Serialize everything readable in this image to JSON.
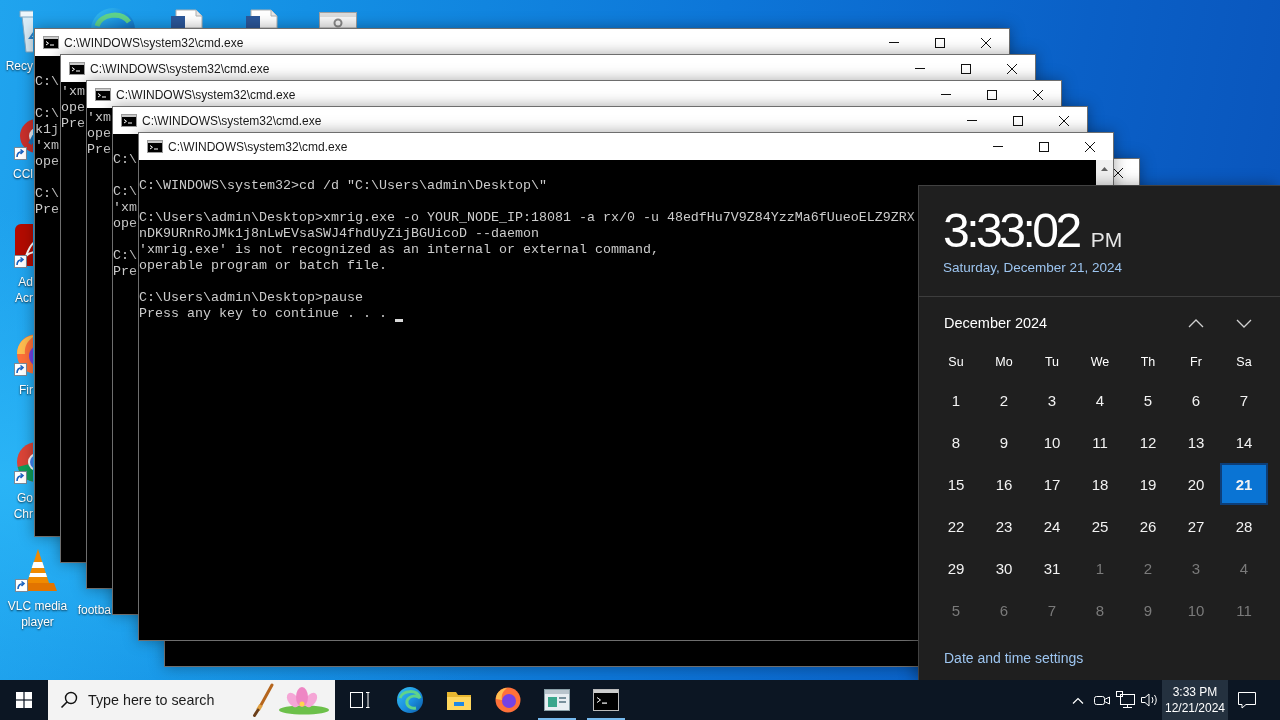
{
  "desktop": {
    "icons": [
      {
        "kind": "recycle_bin",
        "label_lines": [
          "Recy"
        ]
      },
      {
        "kind": "cleaner",
        "label_lines": [
          "CCl"
        ]
      },
      {
        "kind": "pdf_reader",
        "label_lines": [
          "Ad",
          "Acr"
        ]
      },
      {
        "kind": "fox_browser",
        "label_lines": [
          "Fir"
        ]
      },
      {
        "kind": "ring_browser",
        "label_lines": [
          "Go",
          "Chr"
        ]
      },
      {
        "kind": "cone_player",
        "label_lines": [
          "VLC media",
          "player"
        ]
      }
    ],
    "top_row": [
      {
        "kind": "swirl_browser"
      },
      {
        "kind": "document"
      },
      {
        "kind": "document"
      },
      {
        "kind": "settings_file"
      }
    ],
    "second_column": [
      {
        "label_lines": [
          "footba"
        ]
      }
    ]
  },
  "windows": [
    {
      "title": "C:\\WINDOWS\\system32\\cmd.exe",
      "buttons": [
        {
          "kind": "minimize"
        },
        {
          "kind": "maximize"
        },
        {
          "kind": "close"
        }
      ],
      "echo": true,
      "output": [
        [
          "C:\\"
        ],
        [
          "C:\\",
          "k1j",
          "'xm",
          "ope"
        ],
        [
          "C:\\",
          "Pre"
        ]
      ]
    },
    {
      "title": "C:\\WINDOWS\\system32\\cmd.exe",
      "buttons": [
        {
          "kind": "minimize"
        },
        {
          "kind": "maximize"
        },
        {
          "kind": "close"
        }
      ],
      "echo": false,
      "output": [
        [
          "'xm",
          "ope",
          "Pre"
        ]
      ]
    },
    {
      "title": "C:\\WINDOWS\\system32\\cmd.exe",
      "buttons": [
        {
          "kind": "minimize"
        },
        {
          "kind": "maximize"
        },
        {
          "kind": "close"
        }
      ],
      "echo": false,
      "output": [
        [
          "'xm",
          "ope",
          "Pre"
        ]
      ]
    },
    {
      "title": "C:\\WINDOWS\\system32\\cmd.exe",
      "buttons": [
        {
          "kind": "minimize"
        },
        {
          "kind": "maximize"
        },
        {
          "kind": "close"
        }
      ],
      "echo": true,
      "output": [
        [
          "C:\\"
        ],
        [
          "C:\\",
          "'xm",
          "ope"
        ],
        [
          "C:\\",
          "Pre"
        ]
      ]
    },
    {
      "title": "C:\\WINDOWS\\system32\\cmd.exe",
      "buttons": [
        {
          "kind": "minimize"
        },
        {
          "kind": "maximize"
        },
        {
          "kind": "close"
        }
      ],
      "echo": true,
      "cursor": true,
      "output": [
        [
          "C:\\WINDOWS\\system32>cd /d \"C:\\Users\\admin\\Desktop\\\""
        ],
        [
          "C:\\Users\\admin\\Desktop>xmrig.exe -o YOUR_NODE_IP:18081 -a rx/0 -u 48edfHu7V9Z84YzzMa6fUueoELZ9ZRX",
          "nDK9URnRoJMk1j8nLwEVsaSWJ4fhdUyZijBGUicoD --daemon",
          "'xmrig.exe' is not recognized as an internal or external command,",
          "operable program or batch file."
        ],
        [
          "C:\\Users\\admin\\Desktop>pause",
          "Press any key to continue . . ."
        ]
      ]
    },
    {
      "buttons": [
        {
          "kind": "close"
        }
      ]
    }
  ],
  "flyout": {
    "time": "3:33:02",
    "meridiem": "PM",
    "date": "Saturday, December 21, 2024",
    "month": "December 2024",
    "weekdays": [
      "Su",
      "Mo",
      "Tu",
      "We",
      "Th",
      "Fr",
      "Sa"
    ],
    "days": [
      {
        "label": "1",
        "selected": false
      },
      {
        "label": "2",
        "selected": false
      },
      {
        "label": "3",
        "selected": false
      },
      {
        "label": "4",
        "selected": false
      },
      {
        "label": "5",
        "selected": false
      },
      {
        "label": "6",
        "selected": false
      },
      {
        "label": "7",
        "selected": false
      },
      {
        "label": "8",
        "selected": false
      },
      {
        "label": "9",
        "selected": false
      },
      {
        "label": "10",
        "selected": false
      },
      {
        "label": "11",
        "selected": false
      },
      {
        "label": "12",
        "selected": false
      },
      {
        "label": "13",
        "selected": false
      },
      {
        "label": "14",
        "selected": false
      },
      {
        "label": "15",
        "selected": false
      },
      {
        "label": "16",
        "selected": false
      },
      {
        "label": "17",
        "selected": false
      },
      {
        "label": "18",
        "selected": false
      },
      {
        "label": "19",
        "selected": false
      },
      {
        "label": "20",
        "selected": false
      },
      {
        "label": "21",
        "selected": true
      },
      {
        "label": "22",
        "selected": false
      },
      {
        "label": "23",
        "selected": false
      },
      {
        "label": "24",
        "selected": false
      },
      {
        "label": "25",
        "selected": false
      },
      {
        "label": "26",
        "selected": false
      },
      {
        "label": "27",
        "selected": false
      },
      {
        "label": "28",
        "selected": false
      },
      {
        "label": "29",
        "selected": false
      },
      {
        "label": "30",
        "selected": false
      },
      {
        "label": "31",
        "selected": false
      }
    ],
    "next_month_days": [
      "1",
      "2",
      "3",
      "4",
      "5",
      "6",
      "7",
      "8",
      "9",
      "10",
      "11"
    ],
    "settings_link": "Date and time settings"
  },
  "taskbar": {
    "search": {
      "placeholder": "Type here to search"
    },
    "apps": [
      {
        "kind": "swirl_browser",
        "running": false
      },
      {
        "kind": "folder",
        "running": false
      },
      {
        "kind": "fox_browser",
        "running": false
      },
      {
        "kind": "window_app",
        "running": true
      },
      {
        "kind": "console",
        "running": true
      }
    ],
    "tray": {
      "icons": [
        {
          "kind": "chevron"
        },
        {
          "kind": "camera"
        },
        {
          "kind": "network"
        },
        {
          "kind": "speaker"
        }
      ],
      "time": "3:33 PM",
      "date": "12/21/2024",
      "clock_active": true
    }
  }
}
